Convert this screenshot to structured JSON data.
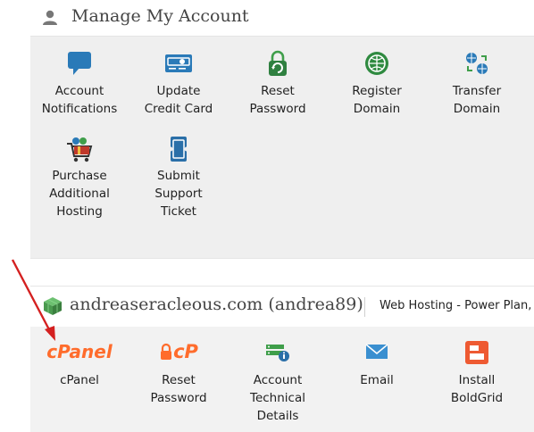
{
  "manage": {
    "title": "Manage My Account",
    "tiles": [
      {
        "line1": "Account",
        "line2": "Notifications",
        "line3": "",
        "icon": "chat-bubble-icon"
      },
      {
        "line1": "Update",
        "line2": "Credit Card",
        "line3": "",
        "icon": "credit-card-icon"
      },
      {
        "line1": "Reset",
        "line2": "Password",
        "line3": "",
        "icon": "padlock-refresh-icon"
      },
      {
        "line1": "Register",
        "line2": "Domain",
        "line3": "",
        "icon": "globe-icon"
      },
      {
        "line1": "Transfer",
        "line2": "Domain",
        "line3": "",
        "icon": "transfer-globes-icon"
      },
      {
        "line1": "Purchase",
        "line2": "Additional",
        "line3": "Hosting",
        "icon": "shopping-cart-icon"
      },
      {
        "line1": "Submit",
        "line2": "Support",
        "line3": "Ticket",
        "icon": "ticket-icon"
      }
    ]
  },
  "account": {
    "domain": "andreaseracleous.com (andrea89)",
    "plan": "Web Hosting - Power Plan, '",
    "tiles": [
      {
        "line1": "cPanel",
        "line2": "",
        "line3": "",
        "logo_text": "cPanel",
        "icon": "cpanel-logo"
      },
      {
        "line1": "Reset",
        "line2": "Password",
        "line3": "",
        "logo_text": "cP",
        "icon": "cpanel-lock-icon"
      },
      {
        "line1": "Account",
        "line2": "Technical",
        "line3": "Details",
        "icon": "server-info-icon"
      },
      {
        "line1": "Email",
        "line2": "",
        "line3": "",
        "icon": "envelope-icon"
      },
      {
        "line1": "Install",
        "line2": "BoldGrid",
        "line3": "",
        "icon": "boldgrid-icon"
      }
    ]
  },
  "colors": {
    "blue": "#2a7ab8",
    "green": "#3f9e4a",
    "orange": "#ff6c2c",
    "arrow_red": "#d42020"
  }
}
